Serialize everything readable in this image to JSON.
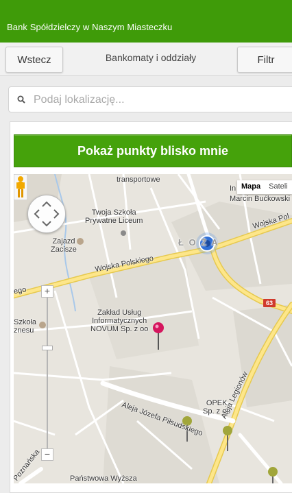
{
  "app": {
    "title": "Bank Spółdzielczy w Naszym Miasteczku"
  },
  "toolbar": {
    "back_label": "Wstecz",
    "title": "Bankomaty i oddziały",
    "filter_label": "Filtr"
  },
  "search": {
    "placeholder": "Podaj lokalizację..."
  },
  "nearby_button": {
    "label": "Pokaż punkty blisko mnie"
  },
  "map": {
    "map_types": {
      "map": "Mapa",
      "satellite": "Sateli"
    },
    "labels": {
      "transportowe": "transportowe",
      "school": "Twoja Szkoła\nPrywatne Liceum",
      "zajazd": "Zajazd\nZacisze",
      "wojska1": "Wojska Polskiego",
      "wojska2": "Wojska Pol",
      "ego": "ego",
      "lozna": "Ł O Ż A",
      "marcin": "Marcin Bućkowski",
      "in": "In",
      "zaklad": "Zakład Usług\nInformatycznych\nNOVUM Sp. z oo",
      "szkola": "Szkoła\nznesu",
      "aleja": "Aleja Józefa Piłsudskiego",
      "opek": "OPEK\nSp. z oo",
      "legionow": "Aleja Legionów",
      "poznanska": "Poznańska",
      "panstwowa": "Państwowa Wyższa",
      "road63": "63"
    }
  }
}
